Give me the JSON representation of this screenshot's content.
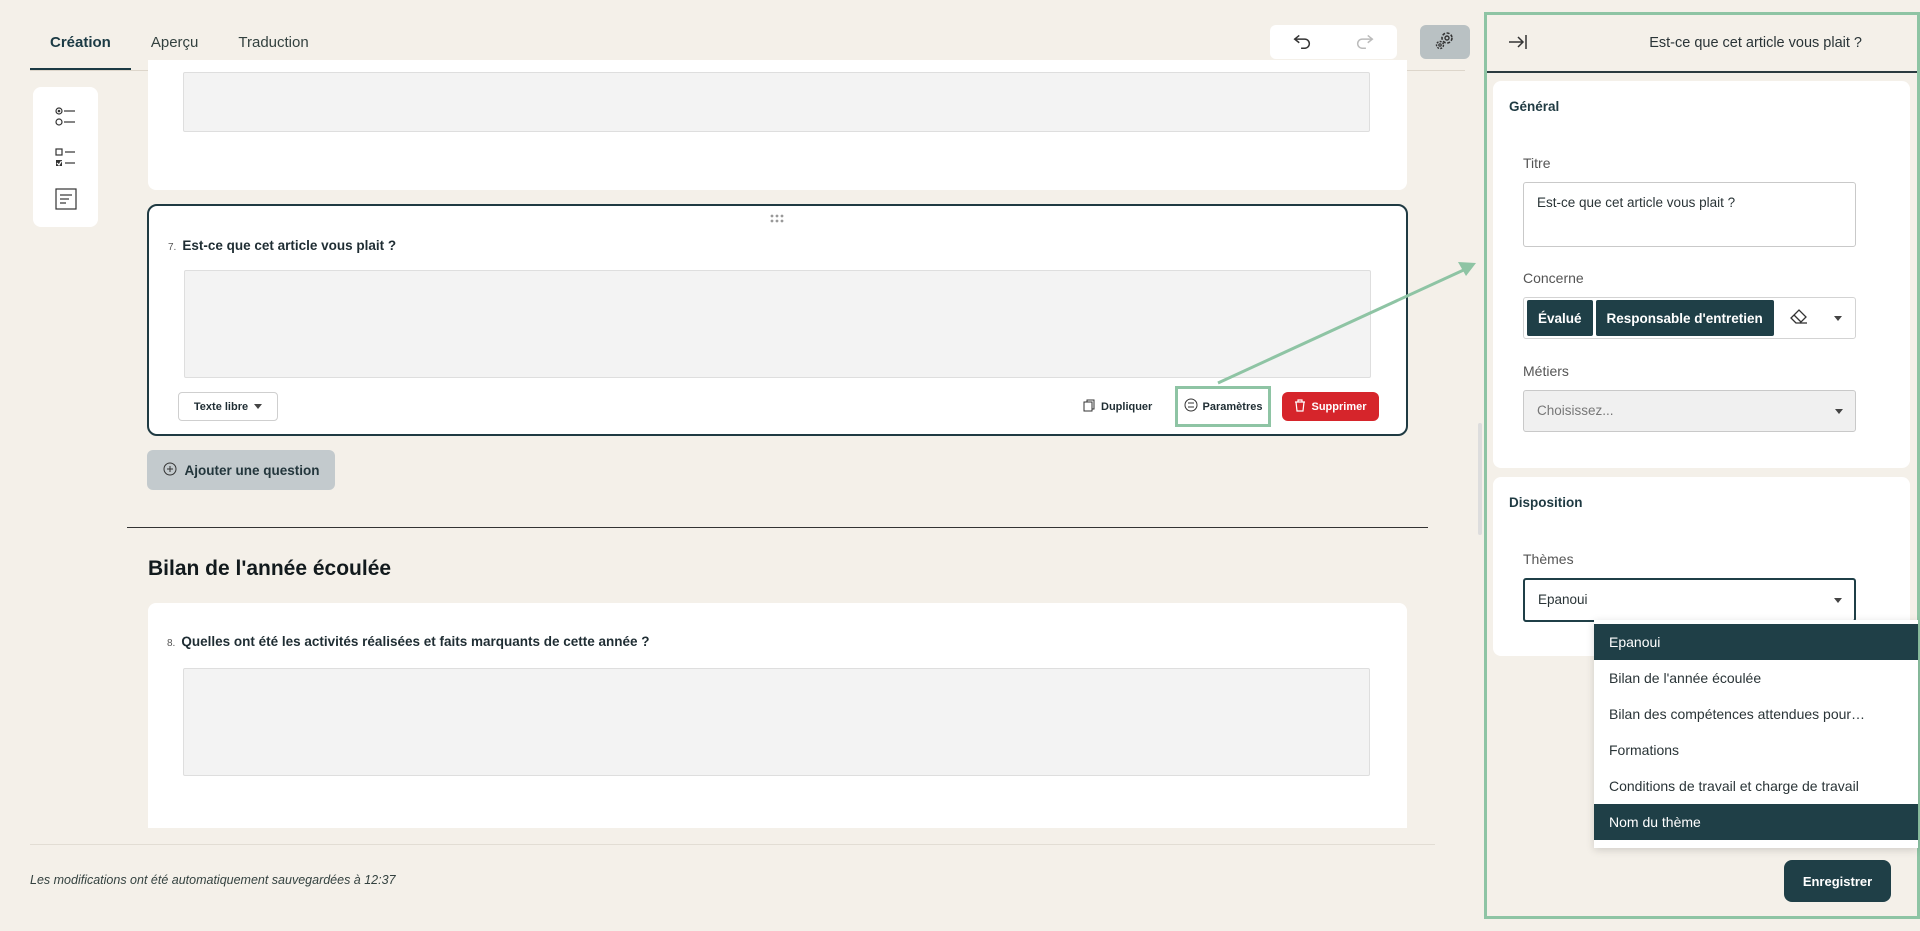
{
  "tabs": [
    {
      "label": "Création",
      "active": true
    },
    {
      "label": "Aperçu",
      "active": false
    },
    {
      "label": "Traduction",
      "active": false
    }
  ],
  "icons": {
    "undo": "undo-icon",
    "redo": "redo-icon",
    "settings": "gear-icon",
    "single_choice": "radio-list-icon",
    "multi_choice": "checkbox-list-icon",
    "free_text": "text-block-icon"
  },
  "questions": [
    {
      "number": "7.",
      "title": "Est-ce que cet article vous plait ?",
      "type_label": "Texte libre",
      "duplicate_label": "Dupliquer",
      "params_label": "Paramètres",
      "delete_label": "Supprimer"
    },
    {
      "number": "8.",
      "title": "Quelles ont été les activités réalisées et faits marquants de cette année ?"
    }
  ],
  "add_question_label": "Ajouter une question",
  "section_title": "Bilan de l'année écoulée",
  "autosave_text": "Les modifications ont été automatiquement sauvegardées à 12:37",
  "panel": {
    "title": "Est-ce que cet article vous plait ?",
    "general_heading": "Général",
    "titre_label": "Titre",
    "titre_value": "Est-ce que cet article vous plait ?",
    "concerne_label": "Concerne",
    "concerne_tags": [
      "Évalué",
      "Responsable d'entretien"
    ],
    "metiers_label": "Métiers",
    "metiers_placeholder": "Choisissez...",
    "disposition_heading": "Disposition",
    "themes_label": "Thèmes",
    "themes_value": "Epanoui",
    "theme_options": [
      {
        "label": "Epanoui",
        "selected": true
      },
      {
        "label": "Bilan de l'année écoulée",
        "selected": false
      },
      {
        "label": "Bilan des compétences attendues pour…",
        "selected": false
      },
      {
        "label": "Formations",
        "selected": false
      },
      {
        "label": "Conditions de travail et charge de travail",
        "selected": false
      },
      {
        "label": "Nom du thème",
        "selected": true
      }
    ],
    "save_label": "Enregistrer"
  },
  "colors": {
    "background": "#f4f0e9",
    "primary": "#1f3f47",
    "danger": "#d6252b",
    "highlight": "#8ec4a4"
  }
}
